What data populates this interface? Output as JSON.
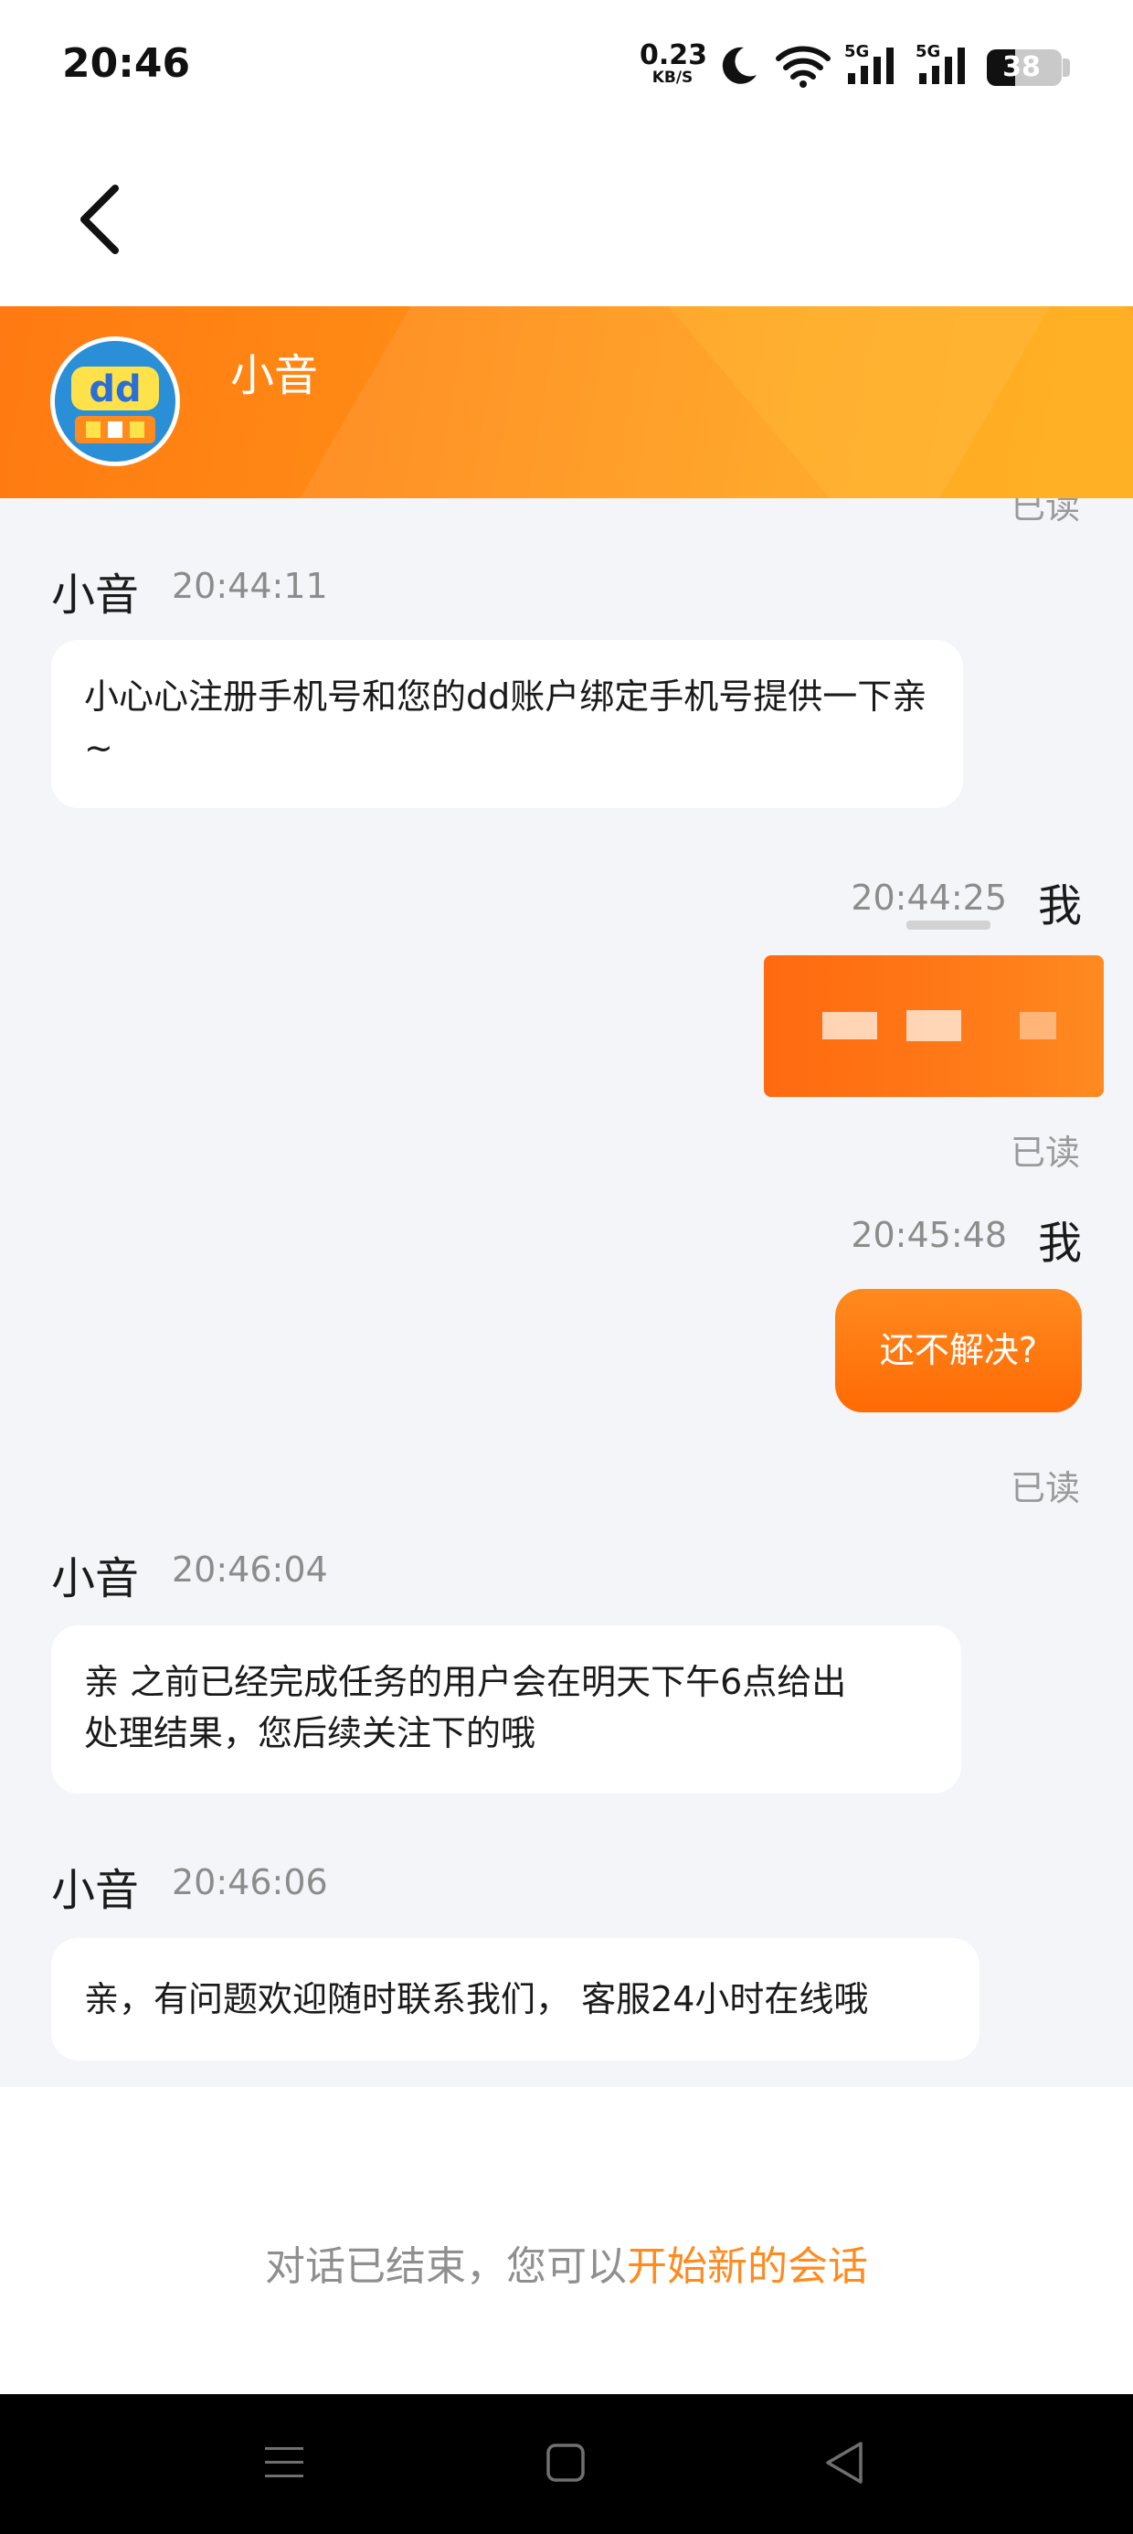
{
  "status_bar": {
    "time": "20:46",
    "net_speed_value": "0.23",
    "net_speed_unit": "KB/S",
    "signal_1_label": "5G",
    "signal_2_label": "5G",
    "battery_level": "38",
    "battery_percent": 38
  },
  "nav": {
    "back_icon": "chevron-left-icon"
  },
  "header": {
    "agent_name": "小音",
    "avatar_text": "dd"
  },
  "chat": {
    "top_read_status": "已读",
    "messages": [
      {
        "sender": "小音",
        "time": "20:44:11",
        "text": "小心心注册手机号和您的dd账户绑定手机号提供一下亲~"
      },
      {
        "sender": "我",
        "time": "20:44:25",
        "read_status": "已读"
      },
      {
        "sender": "我",
        "time": "20:45:48",
        "text": "还不解决?",
        "read_status": "已读"
      },
      {
        "sender": "小音",
        "time": "20:46:04",
        "text_line1": "亲 之前已经完成任务的用户会在明天下午6点给出",
        "text_line2": "处理结果，您后续关注下的哦"
      },
      {
        "sender": "小音",
        "time": "20:46:06",
        "text": "亲，有问题欢迎随时联系我们， 客服24小时在线哦"
      }
    ]
  },
  "footer": {
    "ended_text": "对话已结束，您可以",
    "new_session_link": "开始新的会话"
  },
  "colors": {
    "accent": "#ff8a1e",
    "chat_bg": "#f4f5f9"
  }
}
